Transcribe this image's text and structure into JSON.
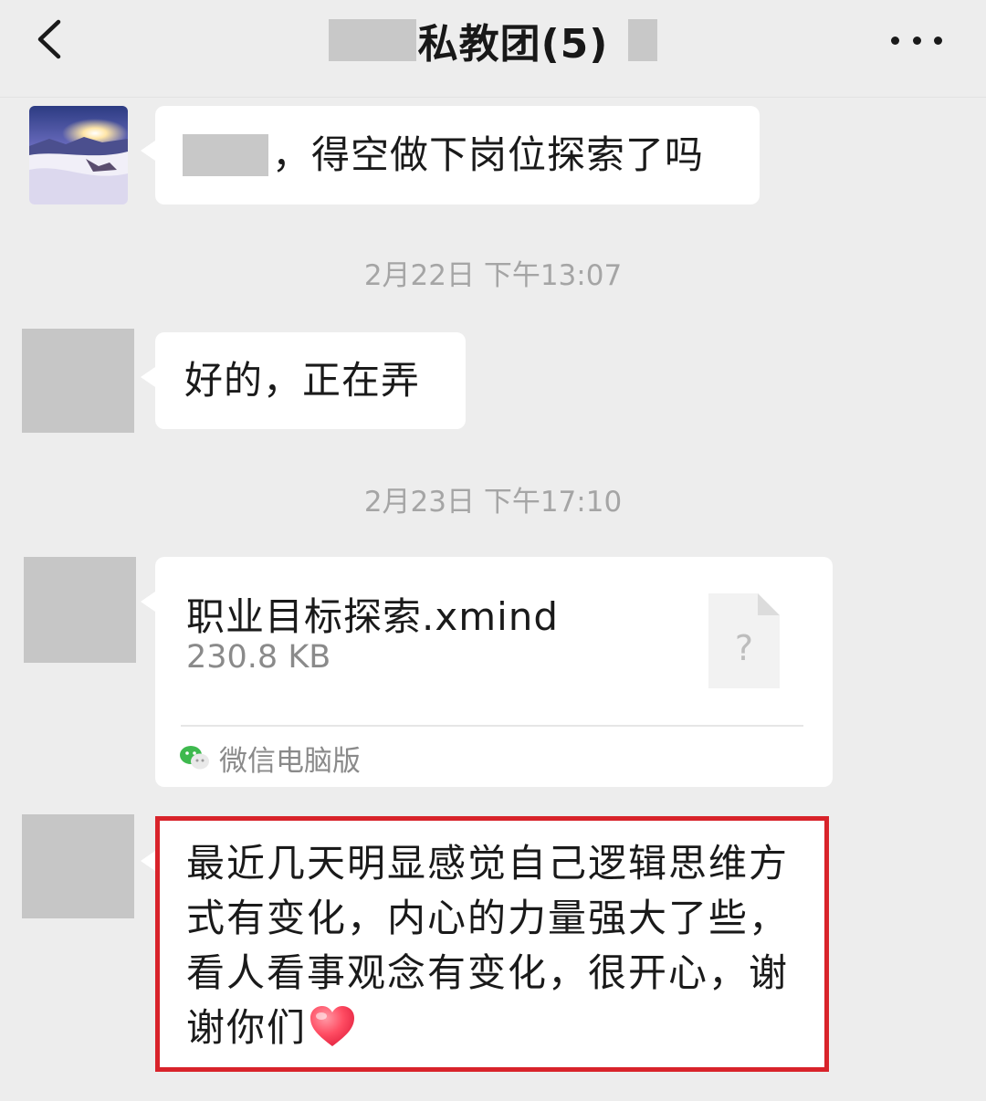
{
  "header": {
    "title": "私教团(5)",
    "back_icon": "chevron-left-icon",
    "more_icon": "more-horizontal-icon"
  },
  "messages": [
    {
      "type": "text",
      "sender_redacted": true,
      "text": "，得空做下岗位探索了吗"
    },
    {
      "type": "timestamp",
      "text": "2月22日 下午13:07"
    },
    {
      "type": "text",
      "text": "好的，正在弄"
    },
    {
      "type": "timestamp",
      "text": "2月23日 下午17:10"
    },
    {
      "type": "file",
      "file_name": "职业目标探索.xmind",
      "file_size": "230.8 KB",
      "file_icon_glyph": "?",
      "source": "微信电脑版",
      "source_icon": "wechat-icon"
    },
    {
      "type": "text",
      "highlighted": true,
      "highlight_color": "#d8232a",
      "lines": [
        "最近几天明显感觉自己逻辑思维方",
        "式有变化，内心的力量强大了些，",
        "看人看事观念有变化，很开心，谢",
        "谢你们"
      ],
      "trailing_icon": "heart-icon"
    }
  ],
  "colors": {
    "background": "#ededed",
    "bubble": "#ffffff",
    "timestamp": "#a5a5a5",
    "redaction": "#c8c8c8",
    "wechat_green": "#3eb94e"
  }
}
